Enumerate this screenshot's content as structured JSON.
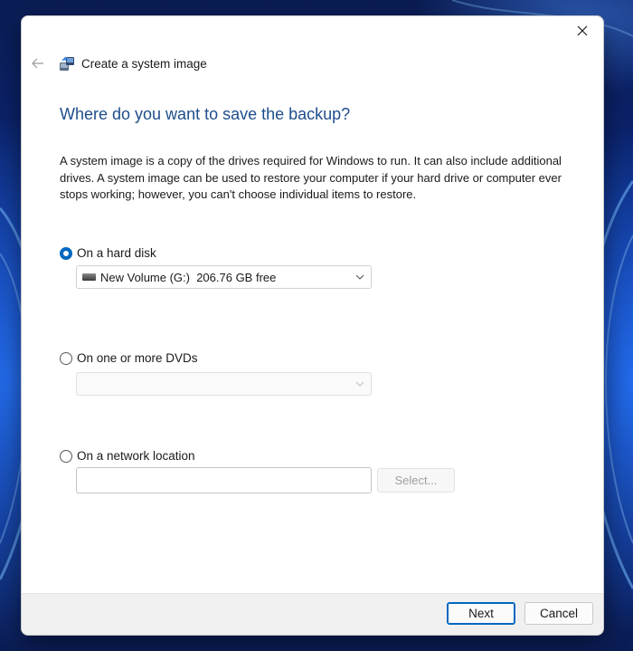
{
  "window": {
    "title": "Create a system image",
    "heading": "Where do you want to save the backup?",
    "description": "A system image is a copy of the drives required for Windows to run. It can also include additional drives. A system image can be used to restore your computer if your hard drive or computer ever stops working; however, you can't choose individual items to restore."
  },
  "options": {
    "hard_disk": {
      "label": "On a hard disk",
      "checked": true,
      "selected_drive": "New Volume (G:)  206.76 GB free"
    },
    "dvd": {
      "label": "On one or more DVDs",
      "checked": false,
      "selected_drive": ""
    },
    "network": {
      "label": "On a network location",
      "checked": false,
      "input_value": "",
      "select_label": "Select..."
    }
  },
  "footer": {
    "next_label": "Next",
    "cancel_label": "Cancel"
  },
  "colors": {
    "accent": "#0067c0",
    "heading": "#1e4d8c"
  },
  "icons": {
    "close": "close-icon",
    "back": "back-arrow-icon",
    "app": "backup-app-icon",
    "drive": "hard-drive-icon",
    "chevron": "chevron-down-icon"
  }
}
